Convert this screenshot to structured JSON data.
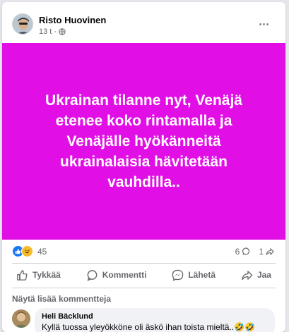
{
  "post": {
    "author": "Risto Huovinen",
    "time": "13 t",
    "more_icon": "⋯",
    "banner": {
      "background": "#e20ee6",
      "text": "Ukrainan tilanne nyt, Venäjä etenee koko rintamalla ja Venäjälle hyökänneitä ukrainalaisia hävitetään vauhdilla.."
    },
    "stats": {
      "reaction_count": "45",
      "comments_count": "6",
      "shares_count": "1"
    },
    "actions": {
      "like": "Tykkää",
      "comment": "Kommentti",
      "send": "Lähetä",
      "share": "Jaa"
    },
    "more_comments": "Näytä lisää kommentteja",
    "comment": {
      "author": "Heli Bäcklund",
      "text": "Kyllä tuossa yleyökköne oli äskö ihan toista mieltä..🤣🤣"
    }
  },
  "colors": {
    "accent": "#1877f2",
    "secondary_text": "#65676b",
    "banner": "#e20ee6"
  }
}
